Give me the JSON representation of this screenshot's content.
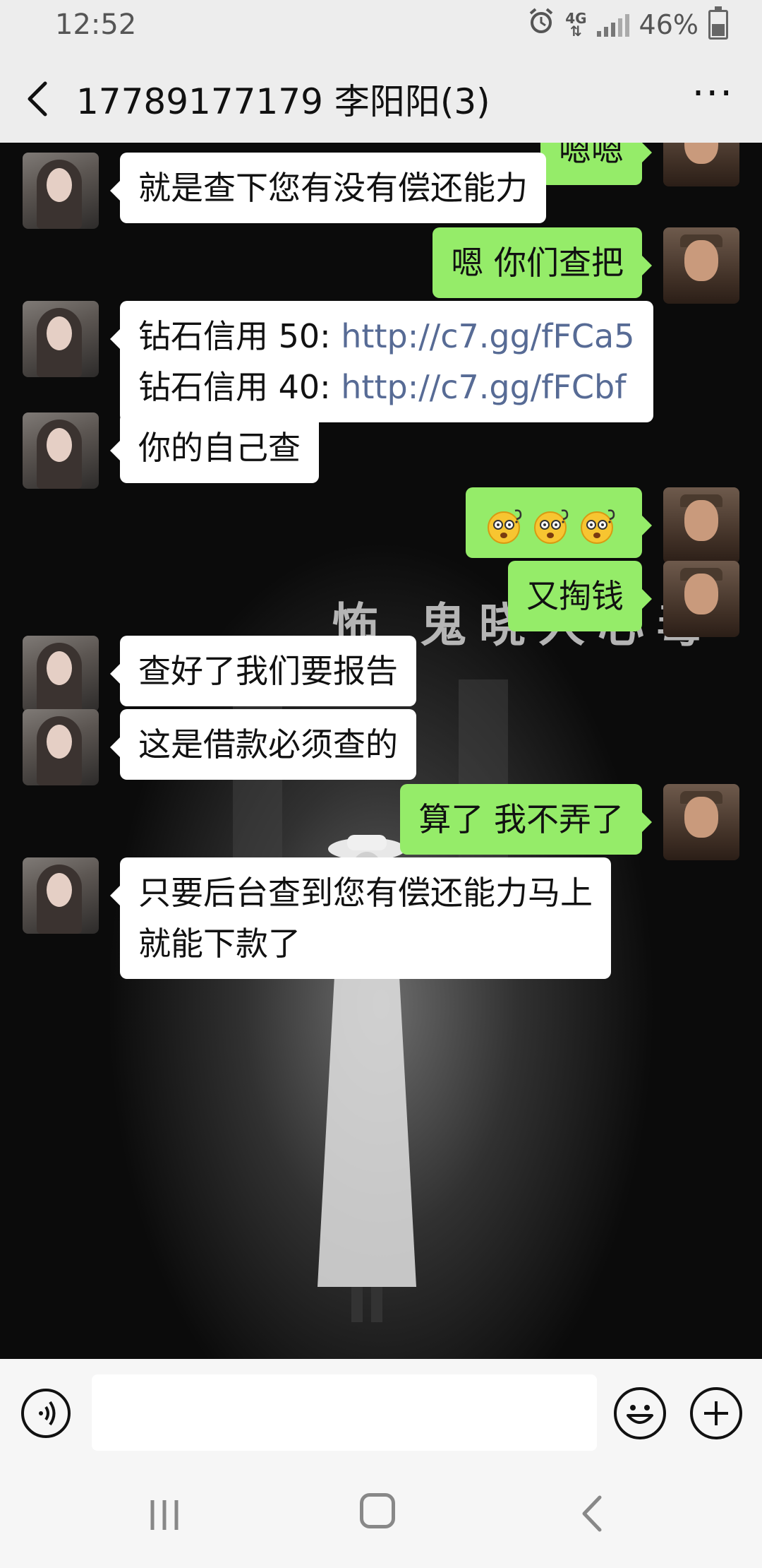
{
  "status_bar": {
    "time": "12:52",
    "network": "4G",
    "battery": "46%",
    "battery_fraction": 0.46,
    "icons": [
      "alarm-icon",
      "network-4g-icon",
      "signal-icon",
      "battery-icon"
    ]
  },
  "header": {
    "title": "17789177179  李阳阳(3)",
    "back_icon": "chevron-left-icon",
    "more_icon": "more-icon"
  },
  "background": {
    "text": "怖  鬼晓人心毒"
  },
  "messages": [
    {
      "side": "right",
      "text": "嗯嗯"
    },
    {
      "side": "left",
      "text": "就是查下您有没有偿还能力"
    },
    {
      "side": "right",
      "text": "嗯 你们查把"
    },
    {
      "side": "left",
      "lines": [
        {
          "prefix": "钻石信用 50: ",
          "link": "http://c7.gg/fFCa5"
        },
        {
          "prefix": "钻石信用 40: ",
          "link": "http://c7.gg/fFCbf"
        }
      ]
    },
    {
      "side": "left",
      "text": "你的自己查"
    },
    {
      "side": "right",
      "emojis": [
        "dizzy-face-emoji",
        "dizzy-face-emoji",
        "dizzy-face-emoji"
      ]
    },
    {
      "side": "right",
      "text": "又掏钱"
    },
    {
      "side": "left",
      "text": "查好了我们要报告"
    },
    {
      "side": "left",
      "text": "这是借款必须查的"
    },
    {
      "side": "right",
      "text": "算了  我不弄了"
    },
    {
      "side": "left",
      "lines": [
        {
          "text": "只要后台查到您有偿还能力马上"
        },
        {
          "text": "就能下款了"
        }
      ]
    }
  ],
  "input_bar": {
    "input_value": "",
    "voice_icon": "voice-icon",
    "emoji_icon": "emoji-icon",
    "plus_icon": "plus-icon"
  },
  "nav_bar": {
    "icons": [
      "recent-apps-icon",
      "home-icon",
      "back-icon"
    ]
  },
  "colors": {
    "own_bubble": "#95ec69",
    "other_bubble": "#ffffff",
    "link": "#576b95",
    "chrome": "#ededed"
  }
}
